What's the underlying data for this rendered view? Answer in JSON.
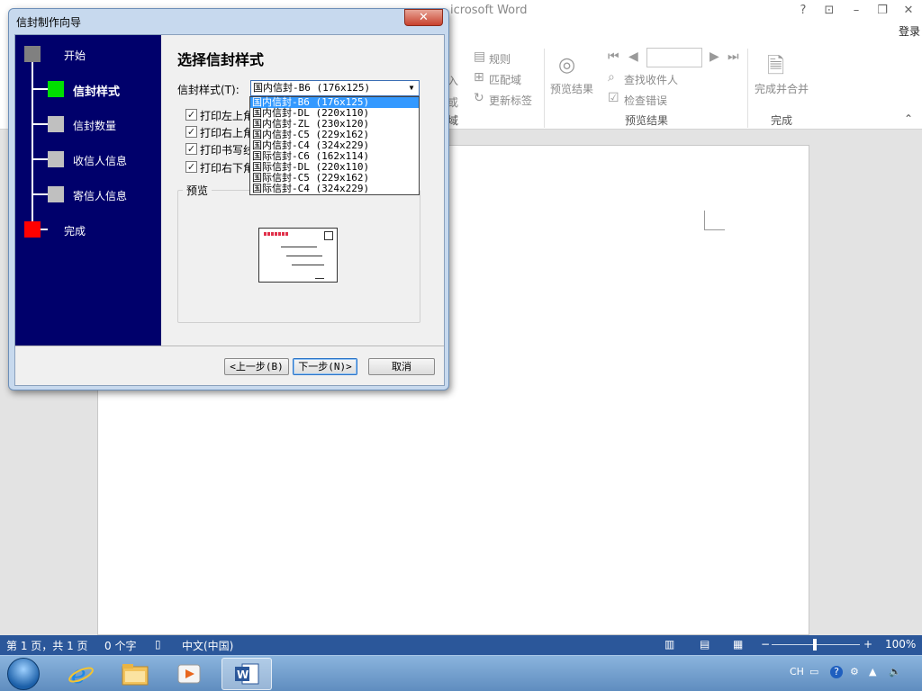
{
  "word": {
    "title": "icrosoft Word",
    "help_btn": "?",
    "restore_ribbon_btn": "⊡",
    "minimize_btn": "–",
    "maximize_btn": "❐",
    "close_btn": "✕",
    "login": "登录"
  },
  "ribbon": {
    "rules": "规则",
    "match_fields": "匹配域",
    "update_labels": "更新标签",
    "preview_results": "预览结果",
    "find_recipient": "查找收件人",
    "check_errors": "检查错误",
    "finish_merge": "完成并合并",
    "group_preview": "预览结果",
    "group_finish": "完成",
    "group_partial": "域",
    "partial_left": "入",
    "partial_left2": "或",
    "collapse": "⌃"
  },
  "statusbar": {
    "page": "第 1 页，共 1 页",
    "words": "0 个字",
    "language": "中文(中国)",
    "zoom_minus": "−",
    "zoom_plus": "+",
    "zoom": "100%"
  },
  "taskbar": {
    "ime": "CH",
    "help": "?"
  },
  "dialog": {
    "title": "信封制作向导",
    "close": "✕",
    "steps": [
      {
        "label": "开始"
      },
      {
        "label": "信封样式"
      },
      {
        "label": "信封数量"
      },
      {
        "label": "收信人信息"
      },
      {
        "label": "寄信人信息"
      },
      {
        "label": "完成"
      }
    ],
    "heading": "选择信封样式",
    "style_label": "信封样式(T):",
    "style_value": "国内信封-B6 (176x125)",
    "options": [
      {
        "label": "打印左上角",
        "checked": "✓"
      },
      {
        "label": "打印右上角",
        "checked": "✓"
      },
      {
        "label": "打印书写线",
        "checked": "✓"
      },
      {
        "label": "打印右下角",
        "checked": "✓"
      }
    ],
    "preview_label": "预览",
    "btn_back": "<上一步(B)",
    "btn_next": "下一步(N)>",
    "btn_cancel": "取消",
    "dropdown": [
      "国内信封-B6 (176x125)",
      "国内信封-DL (220x110)",
      "国内信封-ZL (230x120)",
      "国内信封-C5 (229x162)",
      "国内信封-C4 (324x229)",
      "国际信封-C6 (162x114)",
      "国际信封-DL (220x110)",
      "国际信封-C5 (229x162)",
      "国际信封-C4 (324x229)"
    ]
  },
  "colors": {
    "step_start": "#808080",
    "step_active": "#00e000",
    "step_pending": "#c0c0c0",
    "step_finish": "#ff0000",
    "panel_bg": "#00006b",
    "statusbar_bg": "#2b579a"
  }
}
